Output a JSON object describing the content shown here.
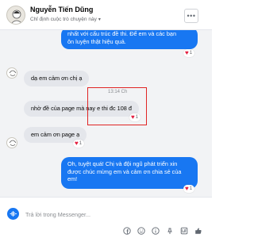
{
  "header": {
    "name": "Nguyễn Tiến Dũng",
    "subtitle": "Chỉ định cuộc trò chuyện này",
    "menu_icon": "more-dots-icon"
  },
  "messages": [
    {
      "from": "me",
      "lines": [
        "nhất với cấu trúc đề thi. Để em và các bạn",
        "ôn luyện thật hiệu quả."
      ],
      "reaction": {
        "icon": "heart",
        "count": "1"
      }
    },
    {
      "from": "contact",
      "text": "dạ em cảm ơn chị ạ"
    },
    {
      "from": "contact",
      "timestamp": "13:14 Ch",
      "text": "nhờ đề của page mà nay e thi đc 108 đ",
      "reaction": {
        "icon": "heart",
        "count": "1"
      }
    },
    {
      "from": "contact",
      "text": "em cảm ơn page ạ",
      "reaction": {
        "icon": "heart",
        "count": "1"
      }
    },
    {
      "from": "me",
      "lines": [
        "Oh, tuyệt quá! Chị và đội ngũ phát triển xin",
        "được chúc mừng em và cảm ơn chia sẻ của",
        "em!"
      ],
      "reaction": {
        "icon": "heart",
        "count": "1"
      }
    }
  ],
  "composer": {
    "placeholder": "Trả lời trong Messenger...",
    "tools": [
      "facebook-icon",
      "emoji-icon",
      "info-icon",
      "pin-icon",
      "gif-icon",
      "thumbs-up-icon"
    ]
  },
  "colors": {
    "accent": "#1877f2",
    "bubble_gray": "#e4e6eb",
    "background": "#f2f3f5",
    "highlight": "#e02424",
    "heart": "#e41e3f"
  }
}
